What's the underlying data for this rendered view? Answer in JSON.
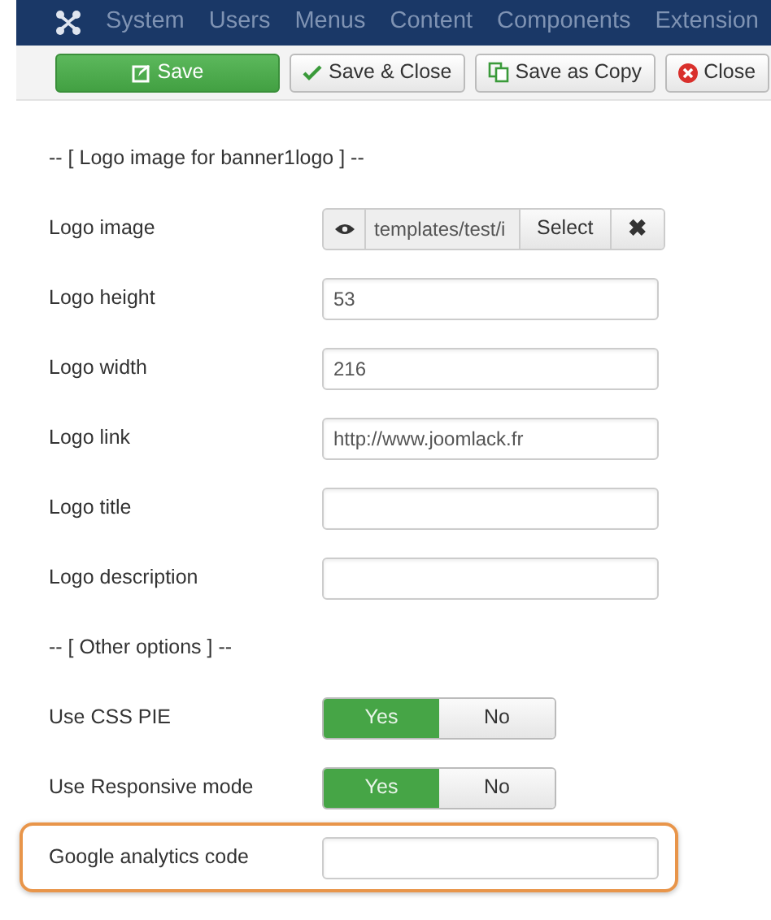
{
  "navbar": {
    "items": [
      "System",
      "Users",
      "Menus",
      "Content",
      "Components",
      "Extension"
    ]
  },
  "toolbar": {
    "buttons": [
      {
        "label": "Save",
        "kind": "save"
      },
      {
        "label": "Save & Close",
        "kind": "check"
      },
      {
        "label": "Save as Copy",
        "kind": "copy"
      },
      {
        "label": "Close",
        "kind": "close"
      }
    ]
  },
  "fields": [
    {
      "kind": "header",
      "label": "-- [ Logo image for banner1logo ] --"
    },
    {
      "kind": "media",
      "label": "Logo image",
      "value": "templates/test/i",
      "button": "Select",
      "clear": "✖"
    },
    {
      "kind": "text",
      "label": "Logo height",
      "value": "53"
    },
    {
      "kind": "text",
      "label": "Logo width",
      "value": "216"
    },
    {
      "kind": "text",
      "label": "Logo link",
      "value": "http://www.joomlack.fr"
    },
    {
      "kind": "text",
      "label": "Logo title"
    },
    {
      "kind": "text",
      "label": "Logo description"
    },
    {
      "kind": "header",
      "label": "-- [ Other options ] --"
    },
    {
      "kind": "toggle",
      "label": "Use CSS PIE",
      "options": [
        {
          "label": "Yes",
          "selected": true
        },
        {
          "label": "No",
          "selected": false
        }
      ]
    },
    {
      "kind": "toggle",
      "label": "Use Responsive mode",
      "options": [
        {
          "label": "Yes",
          "selected": true
        },
        {
          "label": "No",
          "selected": false
        }
      ]
    },
    {
      "kind": "text",
      "label": "Google analytics code",
      "highlighted": true
    }
  ]
}
